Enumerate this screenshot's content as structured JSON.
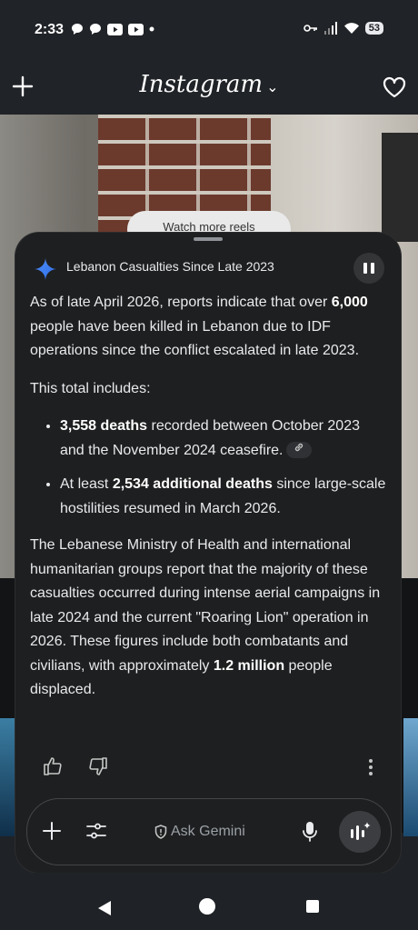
{
  "status_bar": {
    "time": "2:33",
    "battery": "53",
    "icons_left": [
      "chat-bubble-icon",
      "chat-bubble-icon",
      "youtube-icon",
      "youtube-icon",
      "dot-icon"
    ],
    "icons_right": [
      "key-icon",
      "signal-icon",
      "wifi-icon",
      "battery-icon"
    ]
  },
  "instagram": {
    "title": "Instagram",
    "watch_more": "Watch more reels"
  },
  "gemini": {
    "title": "Lebanon Casualties Since Late 2023",
    "para1_pre": "As of late April 2026, reports indicate that over ",
    "para1_bold": "6,000",
    "para1_post": " people have been killed in Lebanon due to IDF operations since the conflict escalated in late 2023.",
    "intro": "This total includes:",
    "bullets": [
      {
        "bold": "3,558 deaths",
        "text": " recorded between October 2023 and the November 2024 ceasefire."
      },
      {
        "pre": "At least ",
        "bold": "2,534 additional deaths",
        "text": " since large-scale hostilities resumed in March 2026."
      }
    ],
    "para3_pre": "The Lebanese Ministry of Health and international humanitarian groups report that the majority of these casualties occurred during intense aerial campaigns in late 2024 and the current \"Roaring Lion\" operation in 2026. These figures include both combatants and civilians, with approximately ",
    "para3_bold": "1.2 million",
    "para3_post": " people displaced.",
    "input_placeholder": "Ask Gemini"
  }
}
